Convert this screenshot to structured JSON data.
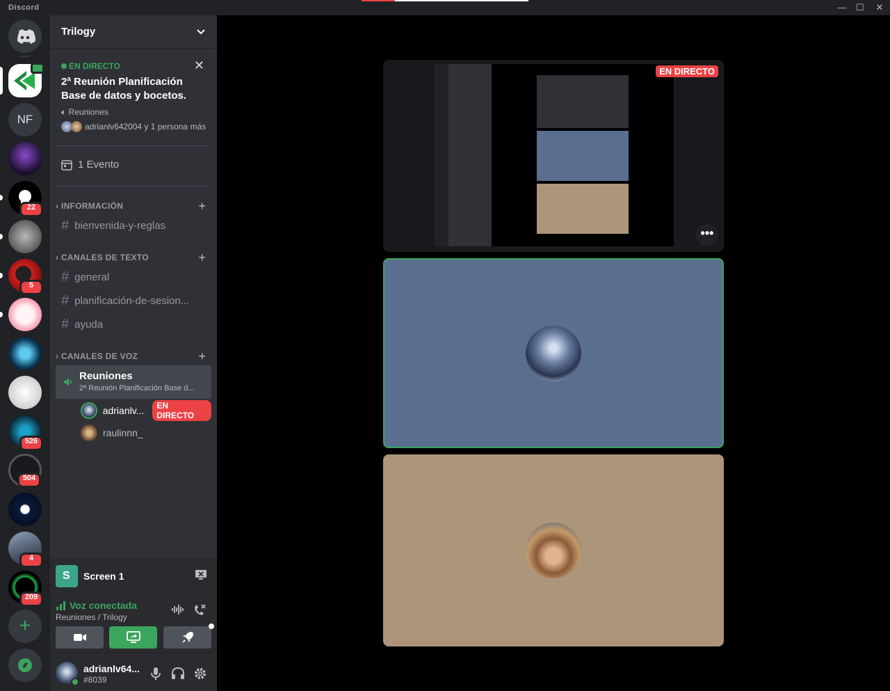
{
  "app": {
    "title": "Discord"
  },
  "colors": {
    "accent_green": "#3ba55d",
    "danger_red": "#ed4245",
    "blurple": "#5865f2"
  },
  "servers": [
    {
      "name": "discord-home",
      "badge": ""
    },
    {
      "name": "trilogy",
      "badge": ""
    },
    {
      "name": "NF",
      "badge": ""
    },
    {
      "name": "server-3",
      "badge": ""
    },
    {
      "name": "server-4",
      "badge": "22"
    },
    {
      "name": "server-5",
      "badge": ""
    },
    {
      "name": "server-6",
      "badge": "5"
    },
    {
      "name": "server-7",
      "badge": ""
    },
    {
      "name": "server-8",
      "badge": ""
    },
    {
      "name": "server-9",
      "badge": ""
    },
    {
      "name": "server-10",
      "badge": "526"
    },
    {
      "name": "server-11",
      "badge": "504"
    },
    {
      "name": "server-12",
      "badge": ""
    },
    {
      "name": "server-13",
      "badge": "4"
    },
    {
      "name": "server-14",
      "badge": "209"
    }
  ],
  "guild": {
    "name": "Trilogy"
  },
  "live": {
    "label": "EN DIRECTO",
    "title": "2ª Reunión Planificación Base de datos y bocetos.",
    "channel": "Reuniones",
    "users": "adrianlv642004 y 1 persona más"
  },
  "event": {
    "label": "1 Evento"
  },
  "categories": {
    "info": "INFORMACIÓN",
    "text": "CANALES DE TEXTO",
    "voice": "CANALES DE VOZ"
  },
  "channels": {
    "rules": "bienvenida-y-reglas",
    "general": "general",
    "planning": "planificación-de-sesion...",
    "help": "ayuda"
  },
  "voice_channel": {
    "name": "Reuniones",
    "topic": "2ª Reunión Planificación Base d...",
    "users": [
      {
        "name": "adrianlv...",
        "live": "EN DIRECTO"
      },
      {
        "name": "raulinnn_",
        "live": ""
      }
    ]
  },
  "screen_panel": {
    "icon_letter": "S",
    "name": "Screen 1"
  },
  "voice_panel": {
    "status": "Voz conectada",
    "location": "Reuniones / Trilogy"
  },
  "user_panel": {
    "name": "adrianlv64...",
    "discriminator": "#8039"
  },
  "stage": {
    "live_tag": "EN DIRECTO",
    "more": "•••"
  }
}
